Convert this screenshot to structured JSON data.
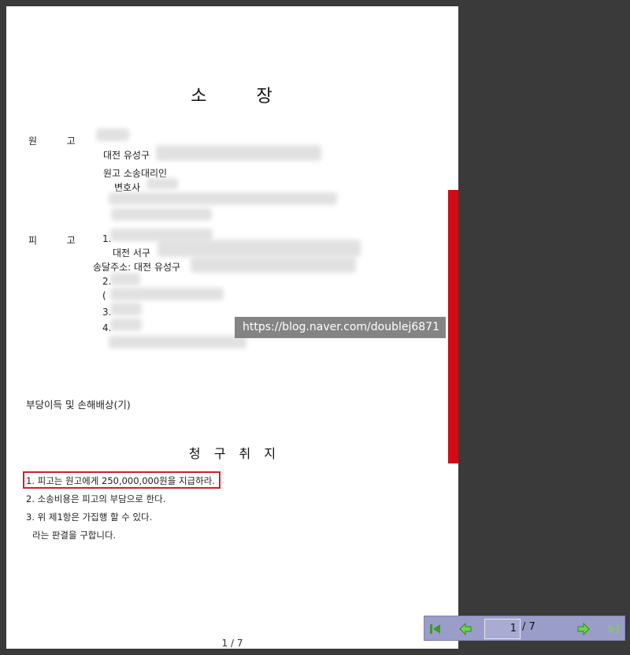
{
  "document": {
    "title_chars": [
      "소",
      "장"
    ],
    "plaintiff": {
      "label_chars": [
        "원",
        "고"
      ],
      "address_prefix": "대전 유성구",
      "agent_label": "원고 소송대리인",
      "lawyer_prefix": "변호사"
    },
    "defendant": {
      "label_chars": [
        "피",
        "고"
      ],
      "item1_num": "1.",
      "item1_address_prefix": "대전 서구",
      "service_address_prefix": "송달주소: 대전 유성구",
      "item2_num": "2.",
      "item2_paren": "(",
      "item3_num": "3.",
      "item4_num": "4."
    },
    "case_name": "부당이득 및 손해배상(기)",
    "claim_section_chars": [
      "청",
      "구",
      "취",
      "지"
    ],
    "claims": [
      "1. 피고는 원고에게 250,000,000원을 지급하라.",
      "2. 소송비용은 피고의 부담으로 한다.",
      "3. 위 제1항은 가집행 할 수 있다."
    ],
    "closing": "라는 판결을 구합니다.",
    "footer": "1 / 7"
  },
  "watermark": "https://blog.naver.com/doublej6871",
  "navigation": {
    "current_page": "1",
    "total_label": "/ 7"
  },
  "colors": {
    "highlight": "#d0202a",
    "side_bar": "#d10a14",
    "nav_background": "#9b9dc9",
    "nav_arrow": "#2e8b1f"
  }
}
